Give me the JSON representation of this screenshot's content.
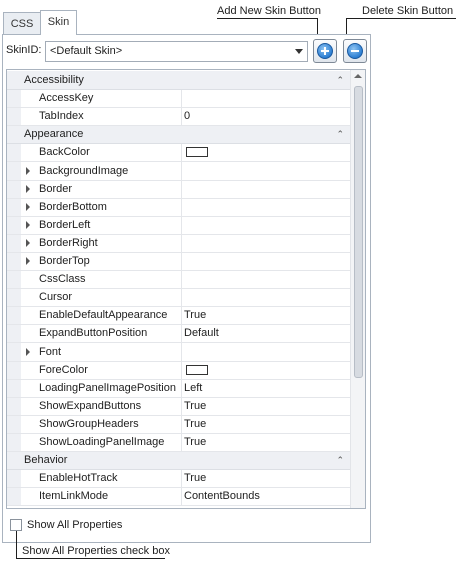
{
  "tabs": [
    {
      "label": "CSS"
    },
    {
      "label": "Skin"
    }
  ],
  "skin": {
    "label": "SkinID:",
    "selected": "<Default Skin>",
    "add_button_icon": "add-circle-icon",
    "delete_button_icon": "remove-circle-icon"
  },
  "callouts": {
    "add": "Add New Skin Button",
    "delete": "Delete Skin Button",
    "show_all": "Show All Properties check box"
  },
  "grid": {
    "rows": [
      {
        "type": "cat",
        "name": "Accessibility"
      },
      {
        "type": "prop",
        "name": "AccessKey",
        "value": ""
      },
      {
        "type": "prop",
        "name": "TabIndex",
        "value": "0"
      },
      {
        "type": "cat",
        "name": "Appearance"
      },
      {
        "type": "prop",
        "name": "BackColor",
        "value": "",
        "swatch": true
      },
      {
        "type": "prop",
        "name": "BackgroundImage",
        "value": "",
        "expandable": true
      },
      {
        "type": "prop",
        "name": "Border",
        "value": "",
        "expandable": true
      },
      {
        "type": "prop",
        "name": "BorderBottom",
        "value": "",
        "expandable": true
      },
      {
        "type": "prop",
        "name": "BorderLeft",
        "value": "",
        "expandable": true
      },
      {
        "type": "prop",
        "name": "BorderRight",
        "value": "",
        "expandable": true
      },
      {
        "type": "prop",
        "name": "BorderTop",
        "value": "",
        "expandable": true
      },
      {
        "type": "prop",
        "name": "CssClass",
        "value": ""
      },
      {
        "type": "prop",
        "name": "Cursor",
        "value": ""
      },
      {
        "type": "prop",
        "name": "EnableDefaultAppearance",
        "value": "True"
      },
      {
        "type": "prop",
        "name": "ExpandButtonPosition",
        "value": "Default"
      },
      {
        "type": "prop",
        "name": "Font",
        "value": "",
        "expandable": true
      },
      {
        "type": "prop",
        "name": "ForeColor",
        "value": "",
        "swatch": true
      },
      {
        "type": "prop",
        "name": "LoadingPanelImagePosition",
        "value": "Left"
      },
      {
        "type": "prop",
        "name": "ShowExpandButtons",
        "value": "True"
      },
      {
        "type": "prop",
        "name": "ShowGroupHeaders",
        "value": "True"
      },
      {
        "type": "prop",
        "name": "ShowLoadingPanelImage",
        "value": "True"
      },
      {
        "type": "cat",
        "name": "Behavior"
      },
      {
        "type": "prop",
        "name": "EnableHotTrack",
        "value": "True"
      },
      {
        "type": "prop",
        "name": "ItemLinkMode",
        "value": "ContentBounds"
      }
    ]
  },
  "show_all": {
    "label": "Show All Properties",
    "checked": false
  }
}
